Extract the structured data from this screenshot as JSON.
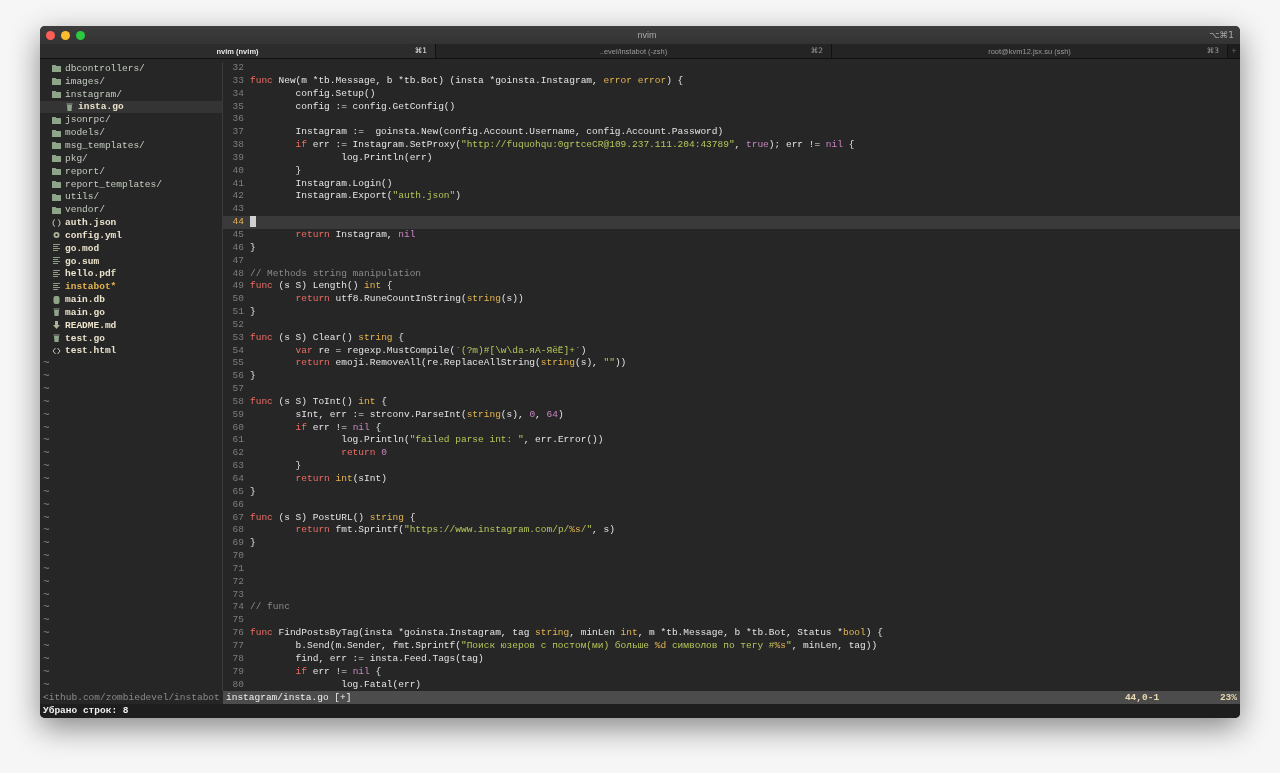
{
  "window": {
    "title": "nvim",
    "shortcut": "⌥⌘1"
  },
  "tabs": [
    {
      "label": "nvim (nvim)",
      "shortcut": "⌘1",
      "selected": true
    },
    {
      "label": "..evel/instabot (-zsh)",
      "shortcut": "⌘2",
      "selected": false
    },
    {
      "label": "root@kvm12.jsx.su (ssh)",
      "shortcut": "⌘3",
      "selected": false
    }
  ],
  "tab_bar": {
    "new_tab": "+"
  },
  "file_tree": {
    "items": [
      {
        "name": "dbcontrollers/",
        "kind": "folder",
        "selected": false,
        "executable": false
      },
      {
        "name": "images/",
        "kind": "folder",
        "selected": false,
        "executable": false
      },
      {
        "name": "instagram/",
        "kind": "folder",
        "selected": false,
        "executable": false,
        "children": [
          {
            "name": "insta.go",
            "kind": "go",
            "selected": true,
            "executable": false
          }
        ]
      },
      {
        "name": "jsonrpc/",
        "kind": "folder",
        "selected": false,
        "executable": false
      },
      {
        "name": "models/",
        "kind": "folder",
        "selected": false,
        "executable": false
      },
      {
        "name": "msg_templates/",
        "kind": "folder",
        "selected": false,
        "executable": false
      },
      {
        "name": "pkg/",
        "kind": "folder",
        "selected": false,
        "executable": false
      },
      {
        "name": "report/",
        "kind": "folder",
        "selected": false,
        "executable": false
      },
      {
        "name": "report_templates/",
        "kind": "folder",
        "selected": false,
        "executable": false
      },
      {
        "name": "utils/",
        "kind": "folder",
        "selected": false,
        "executable": false
      },
      {
        "name": "vendor/",
        "kind": "folder",
        "selected": false,
        "executable": false
      },
      {
        "name": "auth.json",
        "kind": "json",
        "selected": false,
        "executable": false
      },
      {
        "name": "config.yml",
        "kind": "config",
        "selected": false,
        "executable": false
      },
      {
        "name": "go.mod",
        "kind": "text",
        "selected": false,
        "executable": false
      },
      {
        "name": "go.sum",
        "kind": "text",
        "selected": false,
        "executable": false
      },
      {
        "name": "hello.pdf",
        "kind": "text",
        "selected": false,
        "executable": false
      },
      {
        "name": "instabot*",
        "kind": "text",
        "selected": false,
        "executable": true
      },
      {
        "name": "main.db",
        "kind": "database",
        "selected": false,
        "executable": false
      },
      {
        "name": "main.go",
        "kind": "go",
        "selected": false,
        "executable": false
      },
      {
        "name": "README.md",
        "kind": "markdown",
        "selected": false,
        "executable": false
      },
      {
        "name": "test.go",
        "kind": "go",
        "selected": false,
        "executable": false
      },
      {
        "name": "test.html",
        "kind": "html",
        "selected": false,
        "executable": false
      }
    ],
    "empty_markers": [
      "~",
      "~",
      "~",
      "~",
      "~",
      "~",
      "~",
      "~",
      "~",
      "~",
      "~",
      "~",
      "~",
      "~",
      "~",
      "~",
      "~",
      "~",
      "~",
      "~",
      "~",
      "~",
      "~",
      "~",
      "~",
      "~"
    ]
  },
  "editor": {
    "lines": [
      {
        "number": "32",
        "current": false
      },
      {
        "number": "33",
        "current": false,
        "tokens": [
          {
            "kind": "keyword",
            "text": "func"
          },
          {
            "kind": "plain",
            "text": " New(m *tb.Message, b *tb.Bot) (insta *goinsta.Instagram, "
          },
          {
            "kind": "type",
            "text": "error error"
          },
          {
            "kind": "plain",
            "text": ") {"
          }
        ]
      },
      {
        "number": "34",
        "current": false,
        "tokens": [
          {
            "kind": "plain",
            "text": "\tconfig.Setup()"
          }
        ]
      },
      {
        "number": "35",
        "current": false,
        "tokens": [
          {
            "kind": "plain",
            "text": "\tconfig := config.GetConfig()"
          }
        ]
      },
      {
        "number": "36",
        "current": false
      },
      {
        "number": "37",
        "current": false,
        "tokens": [
          {
            "kind": "plain",
            "text": "\tInstagram :=  goinsta.New(config.Account.Username, config.Account.Password)"
          }
        ]
      },
      {
        "number": "38",
        "current": false,
        "tokens": [
          {
            "kind": "keyword",
            "text": "\tif"
          },
          {
            "kind": "plain",
            "text": " err := Instagram.SetProxy("
          },
          {
            "kind": "string",
            "text": "\"http://fuquohqu:0grtceCR@109.237.111.204:43789\""
          },
          {
            "kind": "plain",
            "text": ", "
          },
          {
            "kind": "constant",
            "text": "true"
          },
          {
            "kind": "plain",
            "text": "); err != "
          },
          {
            "kind": "constant",
            "text": "nil"
          },
          {
            "kind": "plain",
            "text": " {"
          }
        ]
      },
      {
        "number": "39",
        "current": false,
        "tokens": [
          {
            "kind": "plain",
            "text": "\t\tlog.Println(err)"
          }
        ]
      },
      {
        "number": "40",
        "current": false,
        "tokens": [
          {
            "kind": "plain",
            "text": "\t}"
          }
        ]
      },
      {
        "number": "41",
        "current": false,
        "tokens": [
          {
            "kind": "plain",
            "text": "\tInstagram.Login()"
          }
        ]
      },
      {
        "number": "42",
        "current": false,
        "tokens": [
          {
            "kind": "plain",
            "text": "\tInstagram.Export("
          },
          {
            "kind": "string",
            "text": "\"auth.json\""
          },
          {
            "kind": "plain",
            "text": ")"
          }
        ]
      },
      {
        "number": "43",
        "current": false
      },
      {
        "number": "44",
        "current": true
      },
      {
        "number": "45",
        "current": false,
        "tokens": [
          {
            "kind": "keyword",
            "text": "\treturn"
          },
          {
            "kind": "plain",
            "text": " Instagram, "
          },
          {
            "kind": "constant",
            "text": "nil"
          }
        ]
      },
      {
        "number": "46",
        "current": false,
        "tokens": [
          {
            "kind": "plain",
            "text": "}"
          }
        ]
      },
      {
        "number": "47",
        "current": false
      },
      {
        "number": "48",
        "current": false,
        "tokens": [
          {
            "kind": "comment",
            "text": "// Methods string manipulation"
          }
        ]
      },
      {
        "number": "49",
        "current": false,
        "tokens": [
          {
            "kind": "keyword",
            "text": "func"
          },
          {
            "kind": "plain",
            "text": " (s S) Length() "
          },
          {
            "kind": "type",
            "text": "int"
          },
          {
            "kind": "plain",
            "text": " {"
          }
        ]
      },
      {
        "number": "50",
        "current": false,
        "tokens": [
          {
            "kind": "keyword",
            "text": "\treturn"
          },
          {
            "kind": "plain",
            "text": " utf8.RuneCountInString("
          },
          {
            "kind": "type",
            "text": "string"
          },
          {
            "kind": "plain",
            "text": "(s))"
          }
        ]
      },
      {
        "number": "51",
        "current": false,
        "tokens": [
          {
            "kind": "plain",
            "text": "}"
          }
        ]
      },
      {
        "number": "52",
        "current": false
      },
      {
        "number": "53",
        "current": false,
        "tokens": [
          {
            "kind": "keyword",
            "text": "func"
          },
          {
            "kind": "plain",
            "text": " (s S) Clear() "
          },
          {
            "kind": "type",
            "text": "string"
          },
          {
            "kind": "plain",
            "text": " {"
          }
        ]
      },
      {
        "number": "54",
        "current": false,
        "tokens": [
          {
            "kind": "keyword",
            "text": "\tvar"
          },
          {
            "kind": "plain",
            "text": " re = regexp.MustCompile("
          },
          {
            "kind": "string",
            "text": "`(?m)#[\\w\\dа-яА-ЯёЁ]+`"
          },
          {
            "kind": "plain",
            "text": ")"
          }
        ]
      },
      {
        "number": "55",
        "current": false,
        "tokens": [
          {
            "kind": "keyword",
            "text": "\treturn"
          },
          {
            "kind": "plain",
            "text": " emoji.RemoveAll(re.ReplaceAllString("
          },
          {
            "kind": "type",
            "text": "string"
          },
          {
            "kind": "plain",
            "text": "(s), "
          },
          {
            "kind": "string",
            "text": "\"\""
          },
          {
            "kind": "plain",
            "text": "))"
          }
        ]
      },
      {
        "number": "56",
        "current": false,
        "tokens": [
          {
            "kind": "plain",
            "text": "}"
          }
        ]
      },
      {
        "number": "57",
        "current": false
      },
      {
        "number": "58",
        "current": false,
        "tokens": [
          {
            "kind": "keyword",
            "text": "func"
          },
          {
            "kind": "plain",
            "text": " (s S) ToInt() "
          },
          {
            "kind": "type",
            "text": "int"
          },
          {
            "kind": "plain",
            "text": " {"
          }
        ]
      },
      {
        "number": "59",
        "current": false,
        "tokens": [
          {
            "kind": "plain",
            "text": "\tsInt, err := strconv.ParseInt("
          },
          {
            "kind": "type",
            "text": "string"
          },
          {
            "kind": "plain",
            "text": "(s), "
          },
          {
            "kind": "constant",
            "text": "0"
          },
          {
            "kind": "plain",
            "text": ", "
          },
          {
            "kind": "constant",
            "text": "64"
          },
          {
            "kind": "plain",
            "text": ")"
          }
        ]
      },
      {
        "number": "60",
        "current": false,
        "tokens": [
          {
            "kind": "keyword",
            "text": "\tif"
          },
          {
            "kind": "plain",
            "text": " err != "
          },
          {
            "kind": "constant",
            "text": "nil"
          },
          {
            "kind": "plain",
            "text": " {"
          }
        ]
      },
      {
        "number": "61",
        "current": false,
        "tokens": [
          {
            "kind": "plain",
            "text": "\t\tlog.Println("
          },
          {
            "kind": "string",
            "text": "\"failed parse int: \""
          },
          {
            "kind": "plain",
            "text": ", err.Error())"
          }
        ]
      },
      {
        "number": "62",
        "current": false,
        "tokens": [
          {
            "kind": "keyword",
            "text": "\t\treturn"
          },
          {
            "kind": "constant",
            "text": " 0"
          }
        ]
      },
      {
        "number": "63",
        "current": false,
        "tokens": [
          {
            "kind": "plain",
            "text": "\t}"
          }
        ]
      },
      {
        "number": "64",
        "current": false,
        "tokens": [
          {
            "kind": "keyword",
            "text": "\treturn"
          },
          {
            "kind": "type",
            "text": " int"
          },
          {
            "kind": "plain",
            "text": "(sInt)"
          }
        ]
      },
      {
        "number": "65",
        "current": false,
        "tokens": [
          {
            "kind": "plain",
            "text": "}"
          }
        ]
      },
      {
        "number": "66",
        "current": false
      },
      {
        "number": "67",
        "current": false,
        "tokens": [
          {
            "kind": "keyword",
            "text": "func"
          },
          {
            "kind": "plain",
            "text": " (s S) PostURL() "
          },
          {
            "kind": "type",
            "text": "string"
          },
          {
            "kind": "plain",
            "text": " {"
          }
        ]
      },
      {
        "number": "68",
        "current": false,
        "tokens": [
          {
            "kind": "keyword",
            "text": "\treturn"
          },
          {
            "kind": "plain",
            "text": " fmt.Sprintf("
          },
          {
            "kind": "string",
            "text": "\"https://www.instagram.com/p/"
          },
          {
            "kind": "type",
            "text": "%s"
          },
          {
            "kind": "string",
            "text": "/\""
          },
          {
            "kind": "plain",
            "text": ", s)"
          }
        ]
      },
      {
        "number": "69",
        "current": false,
        "tokens": [
          {
            "kind": "plain",
            "text": "}"
          }
        ]
      },
      {
        "number": "70",
        "current": false
      },
      {
        "number": "71",
        "current": false
      },
      {
        "number": "72",
        "current": false
      },
      {
        "number": "73",
        "current": false
      },
      {
        "number": "74",
        "current": false,
        "tokens": [
          {
            "kind": "comment",
            "text": "// func"
          }
        ]
      },
      {
        "number": "75",
        "current": false
      },
      {
        "number": "76",
        "current": false,
        "tokens": [
          {
            "kind": "keyword",
            "text": "func"
          },
          {
            "kind": "plain",
            "text": " FindPostsByTag(insta *goinsta.Instagram, tag "
          },
          {
            "kind": "type",
            "text": "string"
          },
          {
            "kind": "plain",
            "text": ", minLen "
          },
          {
            "kind": "type",
            "text": "int"
          },
          {
            "kind": "plain",
            "text": ", m *tb.Message, b *tb.Bot, Status *"
          },
          {
            "kind": "type",
            "text": "bool"
          },
          {
            "kind": "plain",
            "text": ") {"
          }
        ]
      },
      {
        "number": "77",
        "current": false,
        "tokens": [
          {
            "kind": "plain",
            "text": "\tb.Send(m.Sender, fmt.Sprintf("
          },
          {
            "kind": "string",
            "text": "\"Поиск юзеров с постом(ми) больше "
          },
          {
            "kind": "type",
            "text": "%d"
          },
          {
            "kind": "string",
            "text": " символов по тегу #"
          },
          {
            "kind": "type",
            "text": "%s"
          },
          {
            "kind": "string",
            "text": "\""
          },
          {
            "kind": "plain",
            "text": ", minLen, tag))"
          }
        ]
      },
      {
        "number": "78",
        "current": false,
        "tokens": [
          {
            "kind": "plain",
            "text": "\tfind, err := insta.Feed.Tags(tag)"
          }
        ]
      },
      {
        "number": "79",
        "current": false,
        "tokens": [
          {
            "kind": "keyword",
            "text": "\tif"
          },
          {
            "kind": "plain",
            "text": " err != "
          },
          {
            "kind": "constant",
            "text": "nil"
          },
          {
            "kind": "plain",
            "text": " {"
          }
        ]
      },
      {
        "number": "80",
        "current": false,
        "tokens": [
          {
            "kind": "plain",
            "text": "\t\tlog.Fatal(err)"
          }
        ]
      }
    ]
  },
  "status_bar": {
    "tree_path": "<ithub.com/zombiedevel/instabot",
    "file": "instagram/insta.go [+]",
    "position": "44,0-1",
    "scroll": "23%"
  },
  "message": "Убрано строк: 8"
}
